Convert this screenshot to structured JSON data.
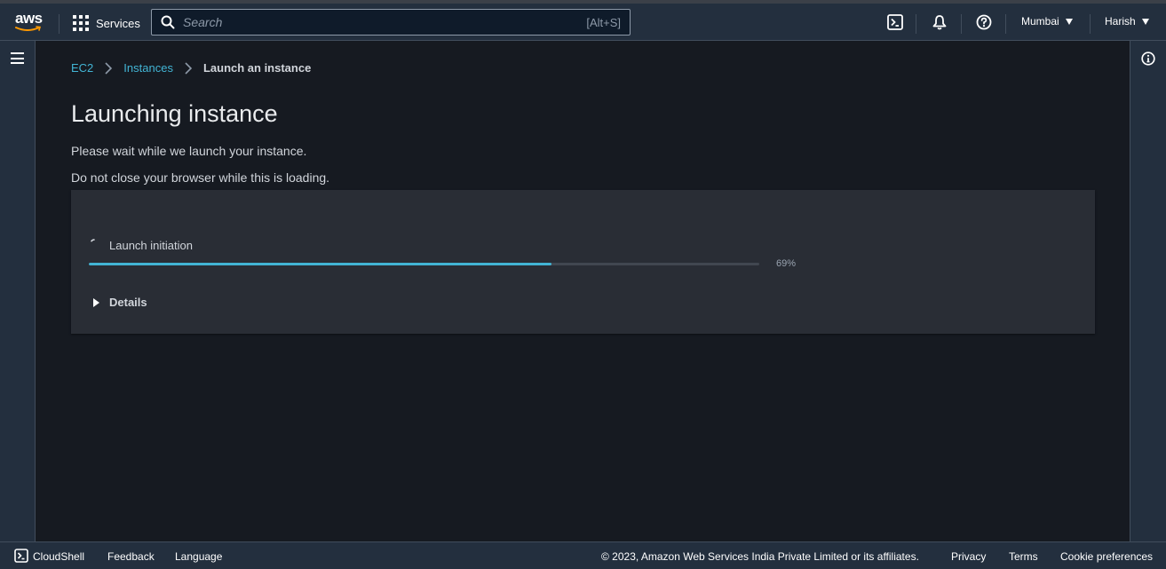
{
  "topnav": {
    "logo_text": "aws",
    "services_label": "Services",
    "search_placeholder": "Search",
    "search_shortcut": "[Alt+S]",
    "region_label": "Mumbai",
    "user_label": "Harish",
    "icons": [
      "cloudshell-icon",
      "notifications-icon",
      "help-icon"
    ]
  },
  "breadcrumb": {
    "items": [
      "EC2",
      "Instances",
      "Launch an instance"
    ]
  },
  "page": {
    "title": "Launching instance",
    "message_1": "Please wait while we launch your instance.",
    "message_2": "Do not close your browser while this is loading."
  },
  "progress": {
    "step_label": "Launch initiation",
    "percent": 69,
    "percent_label": "69%",
    "details_label": "Details",
    "bar_color": "#42b4d4"
  },
  "footer": {
    "cloudshell_label": "CloudShell",
    "feedback_label": "Feedback",
    "language_label": "Language",
    "copyright": "© 2023, Amazon Web Services India Private Limited or its affiliates.",
    "privacy_label": "Privacy",
    "terms_label": "Terms",
    "cookie_label": "Cookie preferences"
  }
}
